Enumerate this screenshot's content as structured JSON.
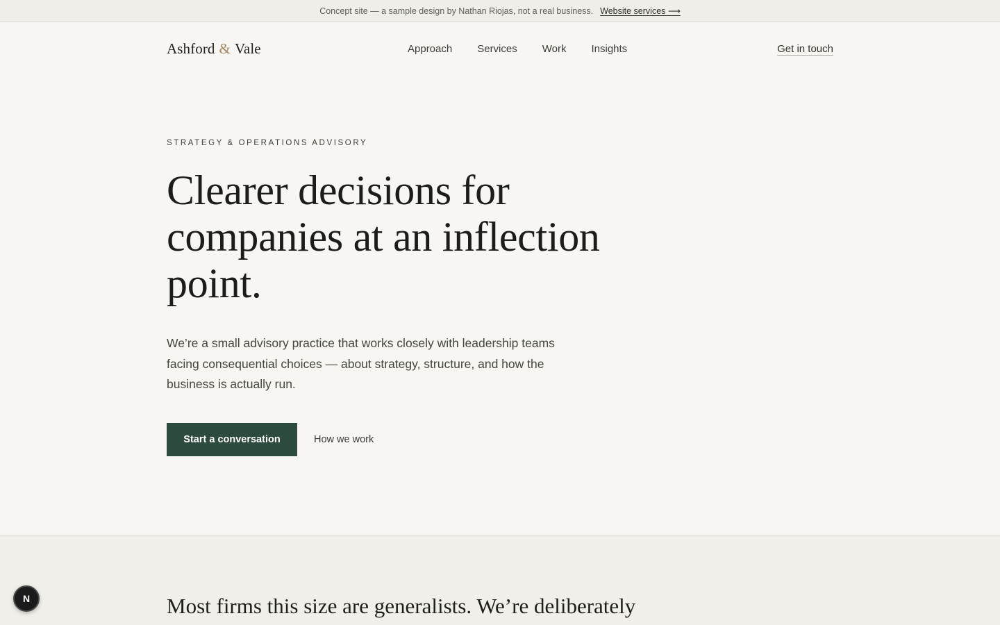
{
  "banner": {
    "note": "Concept site — a sample design by Nathan Riojas, not a real business.",
    "link_label": "Website services ⟶"
  },
  "header": {
    "logo": {
      "first": "Ashford",
      "amp": "&",
      "second": "Vale"
    },
    "nav": [
      {
        "label": "Approach"
      },
      {
        "label": "Services"
      },
      {
        "label": "Work"
      },
      {
        "label": "Insights"
      }
    ],
    "cta_label": "Get in touch"
  },
  "hero": {
    "eyebrow": "STRATEGY & OPERATIONS ADVISORY",
    "headline": "Clearer decisions for companies at an inflection point.",
    "lede": "We’re a small advisory practice that works closely with leadership teams facing consequential choices — about strategy, structure, and how the business is actually run.",
    "primary_cta": "Start a conversation",
    "secondary_cta": "How we work"
  },
  "section2": {
    "heading": "Most firms this size are generalists. We’re deliberately"
  },
  "badge": {
    "letter": "N"
  },
  "colors": {
    "background": "#f7f6f2",
    "accent": "#2d4a3e",
    "logo_amp": "#a3855e"
  }
}
